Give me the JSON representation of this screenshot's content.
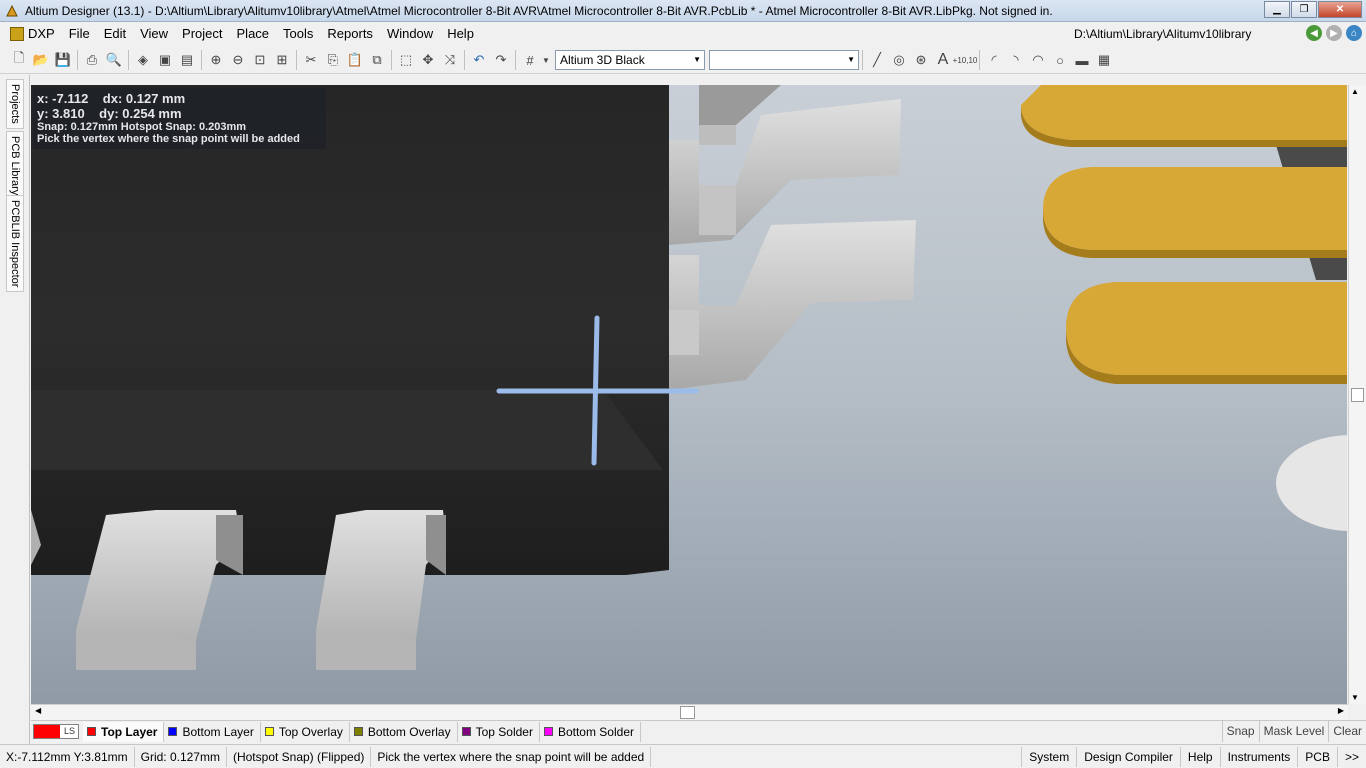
{
  "titlebar": {
    "title": "Altium Designer (13.1) - D:\\Altium\\Library\\Alitumv10library\\Atmel\\Atmel Microcontroller 8-Bit AVR\\Atmel Microcontroller 8-Bit AVR.PcbLib * - Atmel Microcontroller 8-Bit AVR.LibPkg. Not signed in.",
    "minimize": "▁",
    "maximize": "❐",
    "close": "✕"
  },
  "menu": {
    "items": [
      "DXP",
      "File",
      "Edit",
      "View",
      "Project",
      "Place",
      "Tools",
      "Reports",
      "Window",
      "Help"
    ],
    "path": "D:\\Altium\\Library\\Alitumv10library"
  },
  "toolbar": {
    "view_config": "Altium 3D Black",
    "second_combo": ""
  },
  "left_panel": {
    "tabs": [
      "Projects",
      "PCB Library",
      "PCBLIB Inspector"
    ]
  },
  "hud": {
    "x": "x: -7.112",
    "dx": "dx:  0.127 mm",
    "y": "y:  3.810",
    "dy": "dy:  0.254 mm",
    "snap": "Snap: 0.127mm Hotspot Snap: 0.203mm",
    "hint": "Pick the vertex where the snap point will be added"
  },
  "layers": {
    "ls_label": "LS",
    "tabs": [
      {
        "label": "Top Layer",
        "color": "#ff0000",
        "active": true
      },
      {
        "label": "Bottom Layer",
        "color": "#0000ff",
        "active": false
      },
      {
        "label": "Top Overlay",
        "color": "#ffff00",
        "active": false
      },
      {
        "label": "Bottom Overlay",
        "color": "#808000",
        "active": false
      },
      {
        "label": "Top Solder",
        "color": "#800080",
        "active": false
      },
      {
        "label": "Bottom Solder",
        "color": "#ff00ff",
        "active": false
      }
    ],
    "right": [
      "Snap",
      "Mask Level",
      "Clear"
    ]
  },
  "status": {
    "coords": "X:-7.112mm Y:3.81mm",
    "grid": "Grid: 0.127mm",
    "mode": "(Hotspot Snap) (Flipped)",
    "message": "Pick the vertex where the snap point will be added",
    "buttons": [
      "System",
      "Design Compiler",
      "Help",
      "Instruments",
      "PCB",
      ">>"
    ]
  },
  "colors": {
    "pad_gold": "#d8a837",
    "body_dark": "#262626",
    "cursor_blue": "#9bbcea"
  }
}
